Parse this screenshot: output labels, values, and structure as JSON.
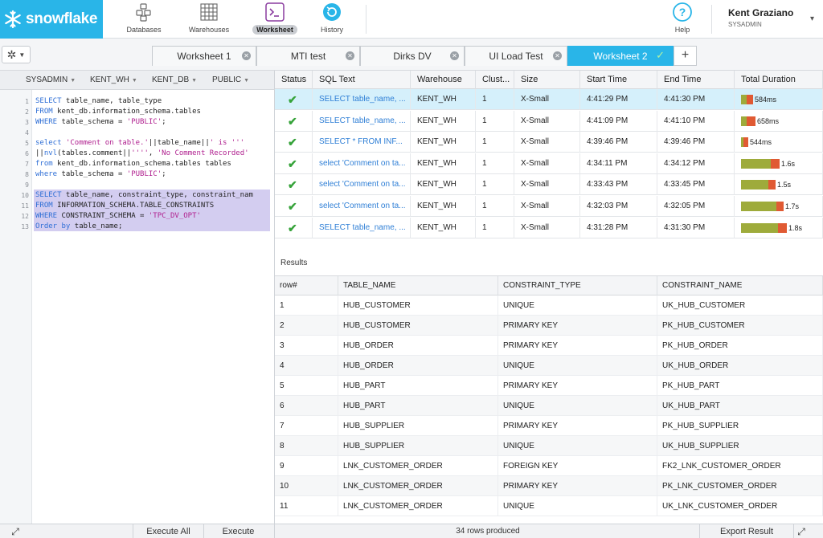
{
  "brand": {
    "name": "snowflake",
    "color": "#29b5e8"
  },
  "nav": {
    "items": [
      {
        "label": "Databases",
        "icon": "database-icon"
      },
      {
        "label": "Warehouses",
        "icon": "warehouse-grid-icon"
      },
      {
        "label": "Worksheet",
        "icon": "terminal-icon",
        "active": true
      },
      {
        "label": "History",
        "icon": "history-icon"
      }
    ],
    "help_label": "Help"
  },
  "user": {
    "name": "Kent Graziano",
    "role": "SYSADMIN"
  },
  "tabs": [
    {
      "label": "Worksheet 1"
    },
    {
      "label": "MTI test"
    },
    {
      "label": "Dirks DV"
    },
    {
      "label": "UI Load Test"
    },
    {
      "label": "Worksheet 2",
      "active": true
    }
  ],
  "context": {
    "role": "SYSADMIN",
    "warehouse": "KENT_WH",
    "database": "KENT_DB",
    "schema": "PUBLIC"
  },
  "editor": {
    "lines": [
      "SELECT table_name, table_type",
      "FROM kent_db.information_schema.tables",
      "WHERE table_schema = 'PUBLIC';",
      "",
      "select 'Comment on table.'||table_name||' is '''",
      "||nvl(tables.comment||'''', 'No Comment Recorded'",
      "from kent_db.information_schema.tables tables",
      "where table_schema = 'PUBLIC';",
      "",
      "SELECT table_name, constraint_type, constraint_nam",
      "FROM INFORMATION_SCHEMA.TABLE_CONSTRAINTS",
      "WHERE CONSTRAINT_SCHEMA = 'TPC_DV_OPT'",
      "Order by table_name;"
    ]
  },
  "left_footer": {
    "execute_all": "Execute All",
    "execute": "Execute"
  },
  "history": {
    "columns": [
      "Status",
      "SQL Text",
      "Warehouse",
      "Clust...",
      "Size",
      "Start Time",
      "End Time",
      "Total Duration"
    ],
    "rows": [
      {
        "sql": "SELECT table_name, ...",
        "warehouse": "KENT_WH",
        "cluster": "1",
        "size": "X-Small",
        "start": "4:41:29 PM",
        "end": "4:41:30 PM",
        "duration": "584ms",
        "frac_a": 0.05,
        "frac_b": 0.06
      },
      {
        "sql": "SELECT table_name, ...",
        "warehouse": "KENT_WH",
        "cluster": "1",
        "size": "X-Small",
        "start": "4:41:09 PM",
        "end": "4:41:10 PM",
        "duration": "658ms",
        "frac_a": 0.05,
        "frac_b": 0.08
      },
      {
        "sql": "SELECT * FROM INF...",
        "warehouse": "KENT_WH",
        "cluster": "1",
        "size": "X-Small",
        "start": "4:39:46 PM",
        "end": "4:39:46 PM",
        "duration": "544ms",
        "frac_a": 0.02,
        "frac_b": 0.04
      },
      {
        "sql": "select 'Comment on ta...",
        "warehouse": "KENT_WH",
        "cluster": "1",
        "size": "X-Small",
        "start": "4:34:11 PM",
        "end": "4:34:12 PM",
        "duration": "1.6s",
        "frac_a": 0.28,
        "frac_b": 0.08
      },
      {
        "sql": "select 'Comment on ta...",
        "warehouse": "KENT_WH",
        "cluster": "1",
        "size": "X-Small",
        "start": "4:33:43 PM",
        "end": "4:33:45 PM",
        "duration": "1.5s",
        "frac_a": 0.26,
        "frac_b": 0.07
      },
      {
        "sql": "select 'Comment on ta...",
        "warehouse": "KENT_WH",
        "cluster": "1",
        "size": "X-Small",
        "start": "4:32:03 PM",
        "end": "4:32:05 PM",
        "duration": "1.7s",
        "frac_a": 0.33,
        "frac_b": 0.07
      },
      {
        "sql": "SELECT table_name, ...",
        "warehouse": "KENT_WH",
        "cluster": "1",
        "size": "X-Small",
        "start": "4:31:28 PM",
        "end": "4:31:30 PM",
        "duration": "1.8s",
        "frac_a": 0.35,
        "frac_b": 0.08
      }
    ]
  },
  "results": {
    "label": "Results",
    "columns": [
      "row#",
      "TABLE_NAME",
      "CONSTRAINT_TYPE",
      "CONSTRAINT_NAME"
    ],
    "rows": [
      [
        "1",
        "HUB_CUSTOMER",
        "UNIQUE",
        "UK_HUB_CUSTOMER"
      ],
      [
        "2",
        "HUB_CUSTOMER",
        "PRIMARY KEY",
        "PK_HUB_CUSTOMER"
      ],
      [
        "3",
        "HUB_ORDER",
        "PRIMARY KEY",
        "PK_HUB_ORDER"
      ],
      [
        "4",
        "HUB_ORDER",
        "UNIQUE",
        "UK_HUB_ORDER"
      ],
      [
        "5",
        "HUB_PART",
        "PRIMARY KEY",
        "PK_HUB_PART"
      ],
      [
        "6",
        "HUB_PART",
        "UNIQUE",
        "UK_HUB_PART"
      ],
      [
        "7",
        "HUB_SUPPLIER",
        "PRIMARY KEY",
        "PK_HUB_SUPPLIER"
      ],
      [
        "8",
        "HUB_SUPPLIER",
        "UNIQUE",
        "UK_HUB_SUPPLIER"
      ],
      [
        "9",
        "LNK_CUSTOMER_ORDER",
        "FOREIGN KEY",
        "FK2_LNK_CUSTOMER_ORDER"
      ],
      [
        "10",
        "LNK_CUSTOMER_ORDER",
        "PRIMARY KEY",
        "PK_LNK_CUSTOMER_ORDER"
      ],
      [
        "11",
        "LNK_CUSTOMER_ORDER",
        "UNIQUE",
        "UK_LNK_CUSTOMER_ORDER"
      ]
    ],
    "rows_produced": "34 rows produced",
    "export_label": "Export Result"
  }
}
